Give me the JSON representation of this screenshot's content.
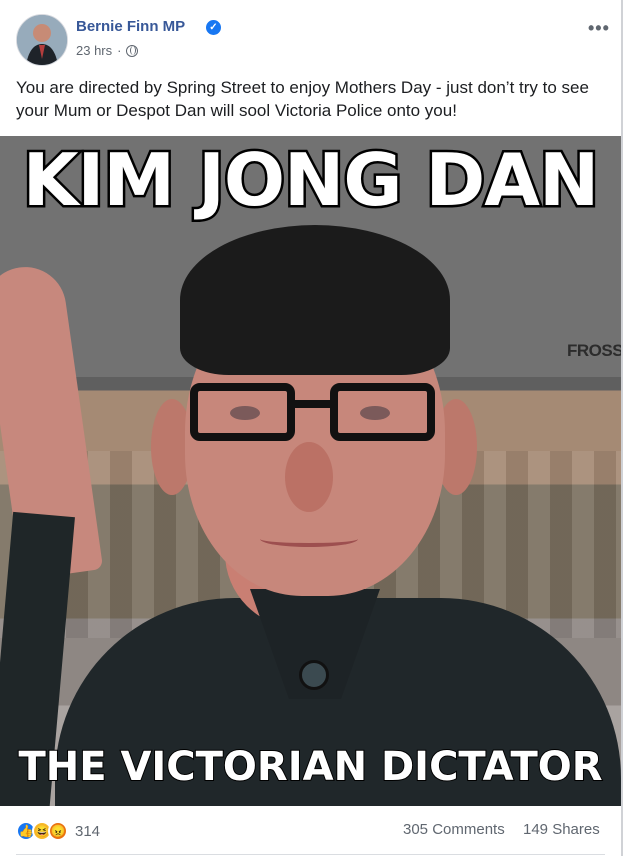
{
  "post": {
    "author": "Bernie Finn MP",
    "time": "23 hrs",
    "text": "You are directed by Spring Street to enjoy Mothers Day - just don’t try to see your Mum or Despot Dan will sool Victoria Police onto you!",
    "more_label": "•••",
    "verified_icon": "verified-icon",
    "globe_icon": "globe-icon"
  },
  "image": {
    "top_caption": "KIM JONG DAN",
    "bottom_caption": "THE VICTORIAN DICTATOR",
    "watermark": "FROSS"
  },
  "footer": {
    "reaction_icons": [
      "like-icon",
      "haha-icon",
      "angry-icon"
    ],
    "reaction_count": "314",
    "comments": "305 Comments",
    "shares": "149 Shares"
  },
  "colors": {
    "author": "#385898",
    "verified": "#1877f2",
    "text": "#1c1e21",
    "meta": "#606770"
  }
}
